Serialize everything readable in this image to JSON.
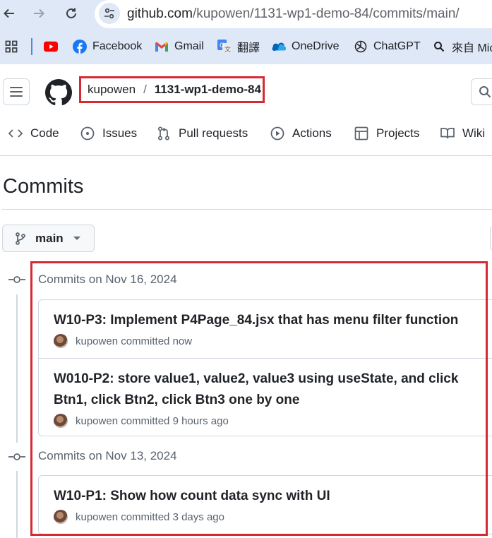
{
  "browser": {
    "url_host": "github.com",
    "url_path": "/kupowen/1131-wp1-demo-84/commits/main/",
    "bookmarks": [
      {
        "label": "",
        "icon": "apps-grid-icon"
      },
      {
        "label": "",
        "icon": "youtube-icon"
      },
      {
        "label": "Facebook",
        "icon": "facebook-icon"
      },
      {
        "label": "Gmail",
        "icon": "gmail-icon"
      },
      {
        "label": "翻譯",
        "icon": "google-translate-icon"
      },
      {
        "label": "OneDrive",
        "icon": "onedrive-icon"
      },
      {
        "label": "ChatGPT",
        "icon": "chatgpt-icon"
      },
      {
        "label": "來自 Mic",
        "icon": "search-icon"
      }
    ]
  },
  "header": {
    "owner": "kupowen",
    "separator": "/",
    "repo": "1131-wp1-demo-84"
  },
  "tabs": [
    {
      "label": "Code",
      "icon": "code-icon"
    },
    {
      "label": "Issues",
      "icon": "issue-opened-icon"
    },
    {
      "label": "Pull requests",
      "icon": "git-pull-request-icon"
    },
    {
      "label": "Actions",
      "icon": "play-icon"
    },
    {
      "label": "Projects",
      "icon": "table-icon"
    },
    {
      "label": "Wiki",
      "icon": "book-icon"
    }
  ],
  "page": {
    "title": "Commits",
    "branch": "main"
  },
  "commit_groups": [
    {
      "heading": "Commits on Nov 16, 2024",
      "commits": [
        {
          "title": "W10-P3: Implement P4Page_84.jsx that has menu filter function",
          "author": "kupowen",
          "action": "committed",
          "time": "now"
        },
        {
          "title": "W010-P2: store value1, value2, value3 using useState, and click Btn1, click Btn2, click Btn3 one by one",
          "author": "kupowen",
          "action": "committed",
          "time": "9 hours ago"
        }
      ]
    },
    {
      "heading": "Commits on Nov 13, 2024",
      "commits": [
        {
          "title": "W10-P1: Show how count data sync with UI",
          "author": "kupowen",
          "action": "committed",
          "time": "3 days ago"
        }
      ]
    }
  ],
  "colors": {
    "annotation_red": "#d42a33",
    "chrome_blue": "#dfe8f7",
    "border": "#d0d7de",
    "muted_text": "#59636e"
  }
}
